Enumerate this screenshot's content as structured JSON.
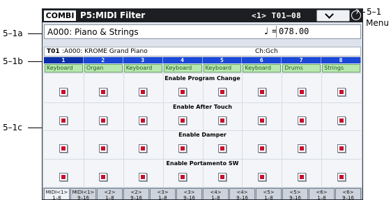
{
  "header": {
    "mode": "COMBI",
    "page": "P5:MIDI Filter",
    "bank_nav": "<1> T01–08"
  },
  "combi": {
    "name": "A000: Piano & Strings",
    "tempo_symbol": "♩ =",
    "tempo": "078.00"
  },
  "timbre": {
    "label": "T01",
    "program": ":A000: KROME Grand Piano",
    "channel": "Ch:Gch"
  },
  "columns": [
    "1",
    "2",
    "3",
    "4",
    "5",
    "6",
    "7",
    "8"
  ],
  "categories": [
    "Keyboard",
    "Organ",
    "Keyboard",
    "Keyboard",
    "Keyboard",
    "Keyboard",
    "Drums",
    "Strings"
  ],
  "sections": [
    {
      "title": "Enable Program Change",
      "checked": [
        true,
        true,
        true,
        true,
        true,
        true,
        true,
        true
      ]
    },
    {
      "title": "Enable After Touch",
      "checked": [
        true,
        true,
        true,
        true,
        true,
        true,
        true,
        true
      ]
    },
    {
      "title": "Enable Damper",
      "checked": [
        true,
        true,
        true,
        true,
        true,
        true,
        true,
        true
      ]
    },
    {
      "title": "Enable Portamento SW",
      "checked": [
        true,
        true,
        true,
        true,
        true,
        true,
        true,
        true
      ]
    }
  ],
  "tabs": [
    {
      "line1": "MIDI<1>",
      "line2": "1–8"
    },
    {
      "line1": "MIDI<1>",
      "line2": "9–16"
    },
    {
      "line1": "<2>",
      "line2": "1–8"
    },
    {
      "line1": "<2>",
      "line2": "9–16"
    },
    {
      "line1": "<3>",
      "line2": "1–8"
    },
    {
      "line1": "<3>",
      "line2": "9–16"
    },
    {
      "line1": "<4>",
      "line2": "1–8"
    },
    {
      "line1": "<4>",
      "line2": "9–16"
    },
    {
      "line1": "<5>",
      "line2": "1–8"
    },
    {
      "line1": "<5>",
      "line2": "9–16"
    },
    {
      "line1": "<6>",
      "line2": "1–8"
    },
    {
      "line1": "<6>",
      "line2": "9–16"
    }
  ],
  "callouts": {
    "c1": "5–1",
    "c1_sub": "Menu",
    "c1a": "5–1a",
    "c1b": "5–1b",
    "c1c": "5–1c"
  }
}
